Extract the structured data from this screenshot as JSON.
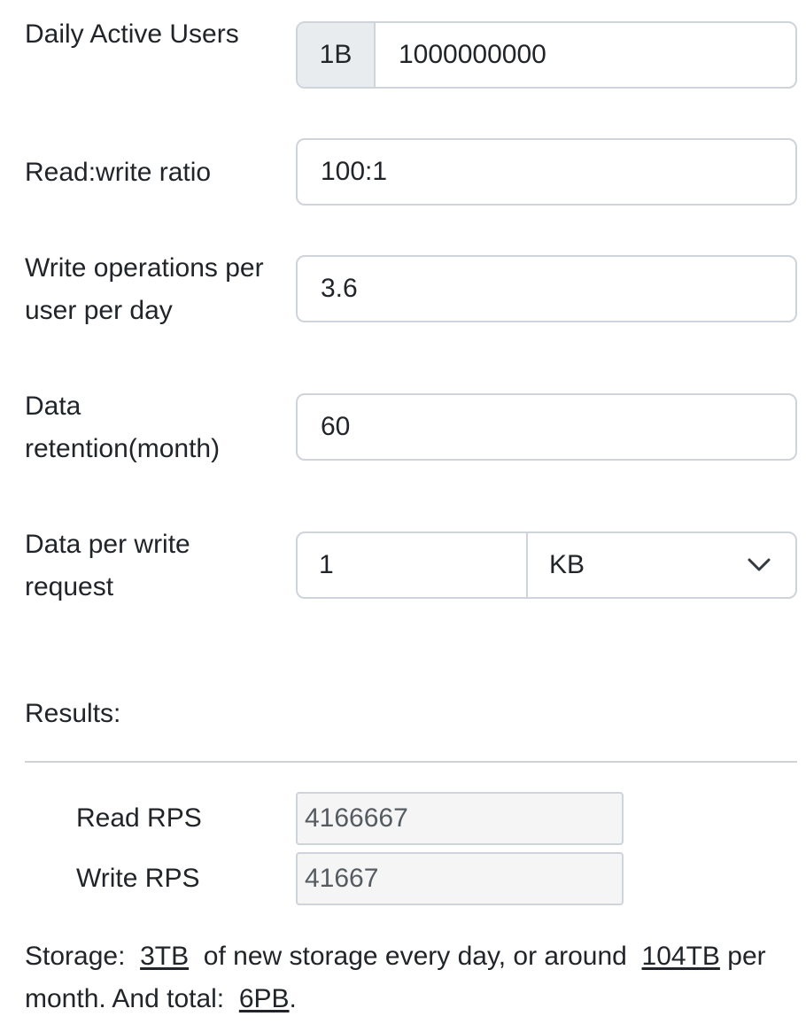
{
  "fields": {
    "dau": {
      "label": "Daily Active Users",
      "prefix": "1B",
      "value": "1000000000"
    },
    "read_write_ratio": {
      "label": "Read:write ratio",
      "value": "100:1"
    },
    "write_ops": {
      "label": "Write operations per user per day",
      "value": "3.6"
    },
    "retention": {
      "label": "Data retention(month)",
      "value": "60"
    },
    "data_per_write": {
      "label": "Data per write request",
      "value": "1",
      "unit_selected": "KB"
    }
  },
  "results": {
    "title": "Results:",
    "read_rps": {
      "label": "Read RPS",
      "value": "4166667"
    },
    "write_rps": {
      "label": "Write RPS",
      "value": "41667"
    }
  },
  "storage": {
    "prefix": "Storage:",
    "daily": "3TB",
    "mid_text": "of new storage every day, or around",
    "monthly": "104TB",
    "per_month_text": "per month. And total:",
    "total": "6PB",
    "end": "."
  },
  "icons": {
    "select_arrow": "chevron-down-icon"
  },
  "colors": {
    "border": "#ced4da",
    "prefix_bg": "#e9ecef",
    "readonly_bg": "#f5f5f5"
  }
}
